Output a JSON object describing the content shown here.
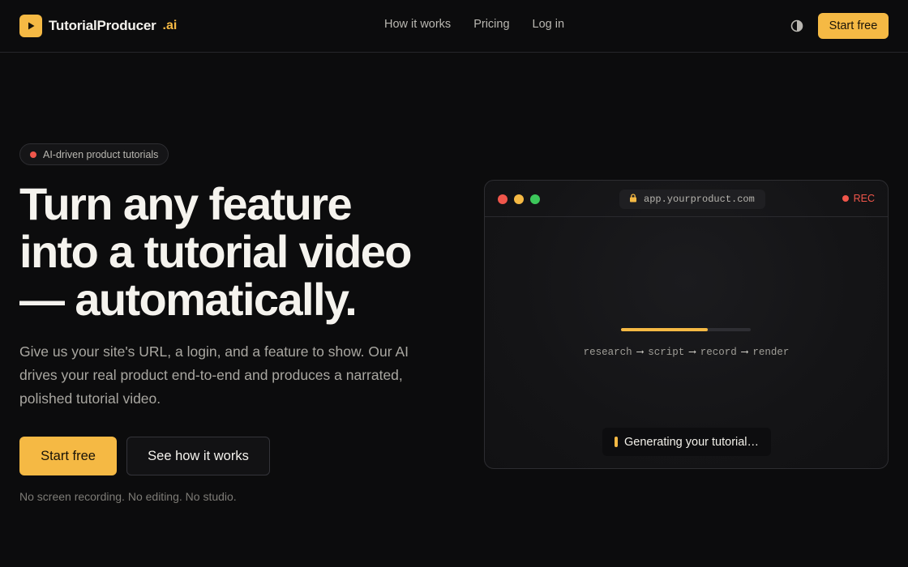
{
  "brand": {
    "name": "TutorialProducer",
    "suffix": ".ai",
    "logo_icon": "play-icon",
    "accent_color": "#f5b944"
  },
  "nav": {
    "items": [
      {
        "label": "How it works"
      },
      {
        "label": "Pricing"
      },
      {
        "label": "Log in"
      }
    ]
  },
  "header": {
    "theme_icon": "contrast-icon",
    "cta_label": "Start free"
  },
  "hero": {
    "badge": "AI-driven product tutorials",
    "headline_lines": [
      "Turn any feature",
      "into a tutorial video",
      "— automatically."
    ],
    "subtext": "Give us your site's URL, a login, and a feature to show. Our AI drives your real product end-to-end and produces a narrated, polished tutorial video.",
    "primary_cta": "Start free",
    "secondary_cta": "See how it works",
    "footnote": "No screen recording. No editing. No studio."
  },
  "preview": {
    "url": "app.yourproduct.com",
    "lock_icon": "lock-icon",
    "rec_label": "REC",
    "rec_color": "#f0564b",
    "progress": 0.67,
    "pipeline": [
      "research",
      "script",
      "record",
      "render"
    ],
    "pipeline_arrow": "⟶",
    "status": "Generating your tutorial…"
  }
}
